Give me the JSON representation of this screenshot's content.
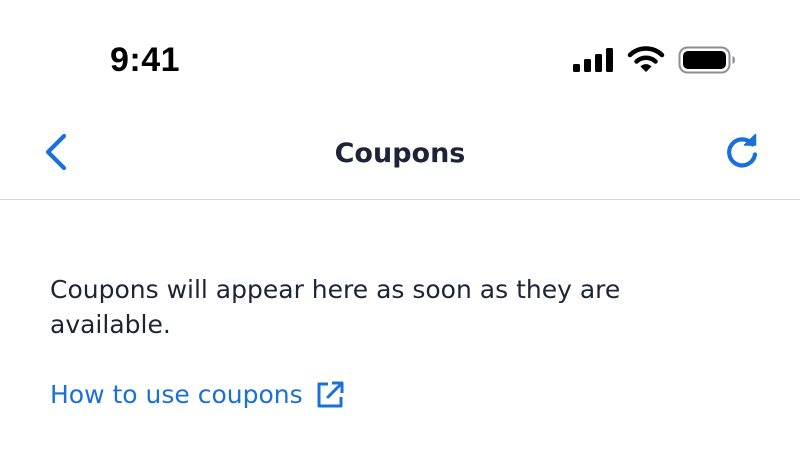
{
  "status_bar": {
    "time": "9:41",
    "icons": [
      "signal-icon",
      "wifi-icon",
      "battery-icon"
    ]
  },
  "nav": {
    "title": "Coupons",
    "back_icon": "chevron-left-icon",
    "refresh_icon": "refresh-icon"
  },
  "content": {
    "empty_message": "Coupons will appear here as soon as they are available.",
    "help_link_label": "How to use coupons",
    "help_link_icon": "external-link-icon"
  },
  "colors": {
    "accent": "#1a6fd8",
    "text_primary": "#1d2436",
    "divider": "#d4d6da",
    "background": "#ffffff"
  }
}
